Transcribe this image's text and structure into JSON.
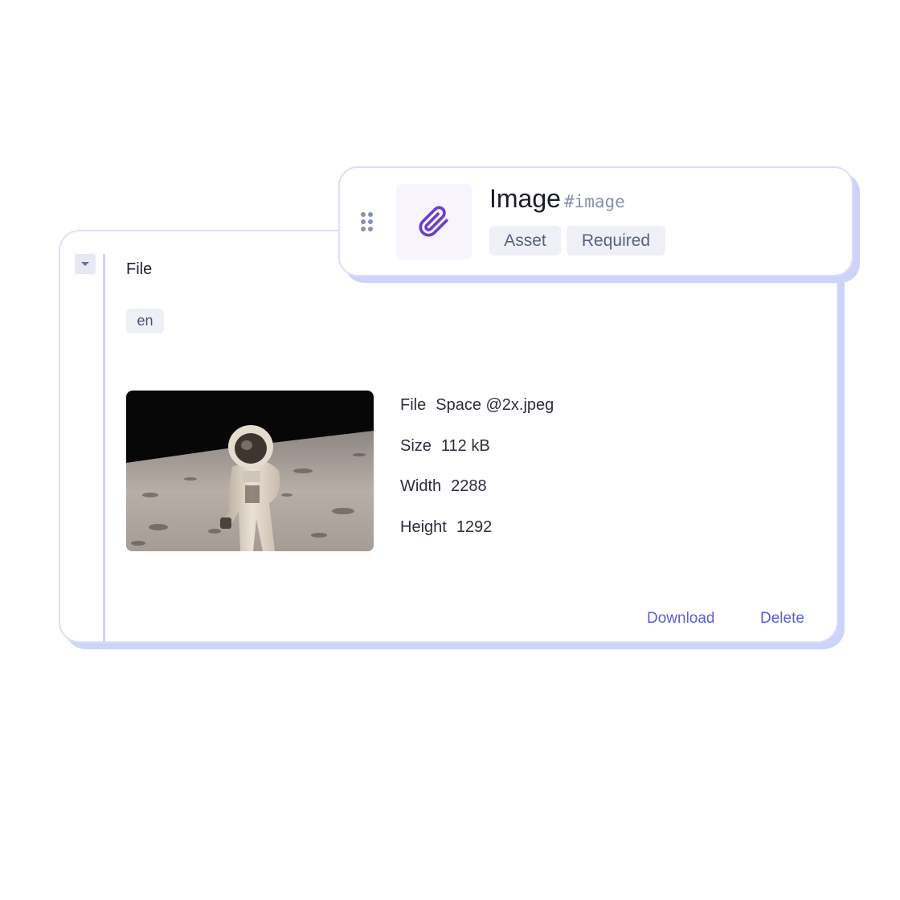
{
  "field_card": {
    "title": "Image",
    "api_id": "#image",
    "tags": [
      "Asset",
      "Required"
    ],
    "icon": "paperclip-icon",
    "drag_icon": "drag-handle-icon"
  },
  "entry_panel": {
    "collapse_icon": "chevron-down-icon",
    "field_label": "File",
    "locale": "en",
    "asset": {
      "thumbnail_alt": "Astronaut on the moon",
      "meta": [
        {
          "key": "File",
          "value": "Space @2x.jpeg"
        },
        {
          "key": "Size",
          "value": "112 kB"
        },
        {
          "key": "Width",
          "value": "2288"
        },
        {
          "key": "Height",
          "value": "1292"
        }
      ]
    },
    "actions": {
      "download": "Download",
      "delete": "Delete"
    }
  },
  "colors": {
    "accent": "#5b5fd6",
    "icon_purple": "#6b3fc8",
    "card_shadow": "#cdd3fb"
  }
}
